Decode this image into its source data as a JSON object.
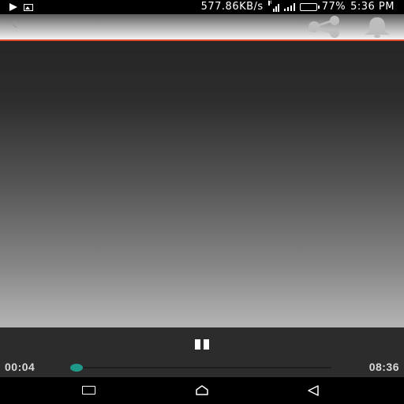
{
  "status_bar": {
    "net_speed": "577.86KB/s",
    "wifi_tag": "H",
    "battery": "77%",
    "battery_level": 0.77,
    "time": "5:36 PM",
    "icons": [
      "play-icon",
      "gallery-icon",
      "wifi-signal-icon",
      "cell-signal-icon",
      "battery-icon"
    ]
  },
  "app_bar": {
    "icons": [
      "back-arrow-icon",
      "share-icon",
      "bell-icon"
    ],
    "accent_line_color": "#e34a2a"
  },
  "player": {
    "current_time": "00:04",
    "total_time": "08:36",
    "progress": 0.008,
    "accent_color": "#1f9a8a",
    "state": "playing",
    "pause_icon": "pause-icon"
  },
  "nav_bar": {
    "icons": [
      "recents-icon",
      "home-icon",
      "back-icon"
    ]
  }
}
